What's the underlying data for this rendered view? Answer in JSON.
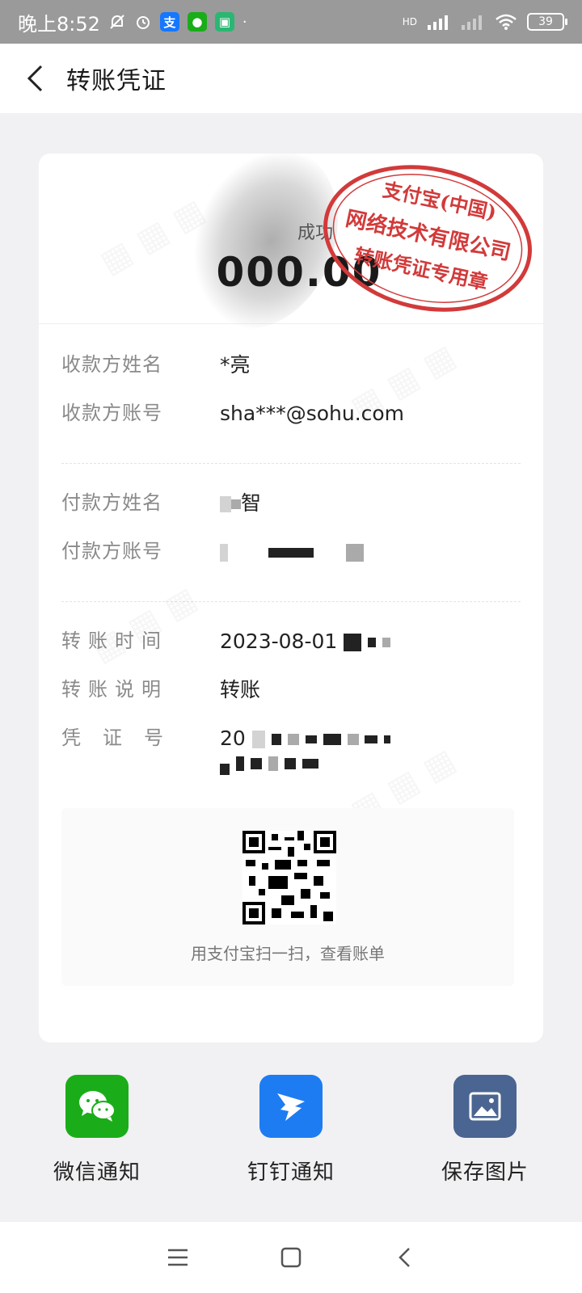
{
  "status_bar": {
    "time": "晚上8:52",
    "network": "HD",
    "battery": "39"
  },
  "header": {
    "title": "转账凭证"
  },
  "receipt": {
    "status": "成功",
    "amount": "000.00",
    "seal": {
      "line1": "支付宝(中国)",
      "line2": "网络技术有限公司",
      "line3": "转账凭证专用章"
    },
    "payee": {
      "name_label": "收款方姓名",
      "name_value": "*亮",
      "account_label": "收款方账号",
      "account_value": "sha***@sohu.com"
    },
    "payer": {
      "name_label": "付款方姓名",
      "name_value": "智",
      "account_label": "付款方账号"
    },
    "details": {
      "time_label": "转账时间",
      "time_value": "2023-08-01",
      "memo_label": "转账说明",
      "memo_value": "转账",
      "voucher_label": "凭证号",
      "voucher_value": "20"
    },
    "qr_caption": "用支付宝扫一扫，查看账单"
  },
  "actions": [
    {
      "label": "微信通知",
      "icon": "wechat-icon",
      "color": "#1aad19"
    },
    {
      "label": "钉钉通知",
      "icon": "dingtalk-icon",
      "color": "#1e7cf2"
    },
    {
      "label": "保存图片",
      "icon": "image-icon",
      "color": "#4a6591"
    }
  ],
  "colors": {
    "seal_red": "#d23a3a",
    "background": "#f1f1f3"
  }
}
